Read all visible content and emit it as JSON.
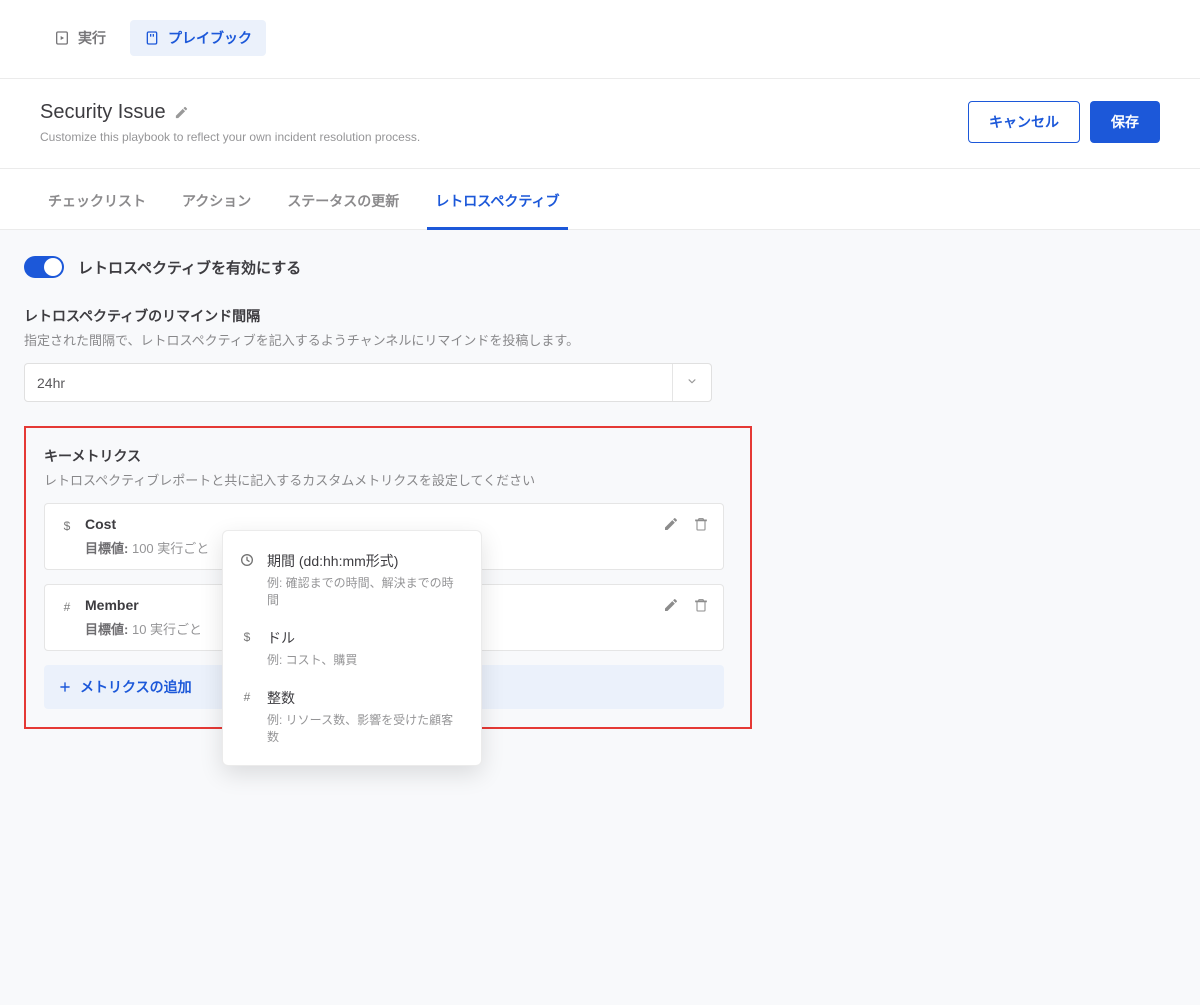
{
  "topnav": {
    "run": "実行",
    "playbook": "プレイブック"
  },
  "header": {
    "title": "Security Issue",
    "subtitle": "Customize this playbook to reflect your own incident resolution process.",
    "cancel": "キャンセル",
    "save": "保存"
  },
  "subtabs": {
    "checklist": "チェックリスト",
    "actions": "アクション",
    "status": "ステータスの更新",
    "retrospective": "レトロスペクティブ"
  },
  "retro": {
    "enable_label": "レトロスペクティブを有効にする",
    "remind_title": "レトロスペクティブのリマインド間隔",
    "remind_desc": "指定された間隔で、レトロスペクティブを記入するようチャンネルにリマインドを投稿します。",
    "remind_value": "24hr",
    "metrics_title": "キーメトリクス",
    "metrics_desc": "レトロスペクティブレポートと共に記入するカスタムメトリクスを設定してください",
    "target_label": "目標値:",
    "metrics": [
      {
        "name": "Cost",
        "target": "100 実行ごと",
        "icon": "dollar"
      },
      {
        "name": "Member",
        "target": "10 実行ごと",
        "icon": "hash"
      }
    ],
    "add_label": "メトリクスの追加",
    "type_menu": [
      {
        "label": "期間 (dd:hh:mm形式)",
        "sub": "例: 確認までの時間、解決までの時間",
        "icon": "clock"
      },
      {
        "label": "ドル",
        "sub": "例: コスト、購買",
        "icon": "dollar"
      },
      {
        "label": "整数",
        "sub": "例: リソース数、影響を受けた顧客数",
        "icon": "hash"
      }
    ]
  }
}
